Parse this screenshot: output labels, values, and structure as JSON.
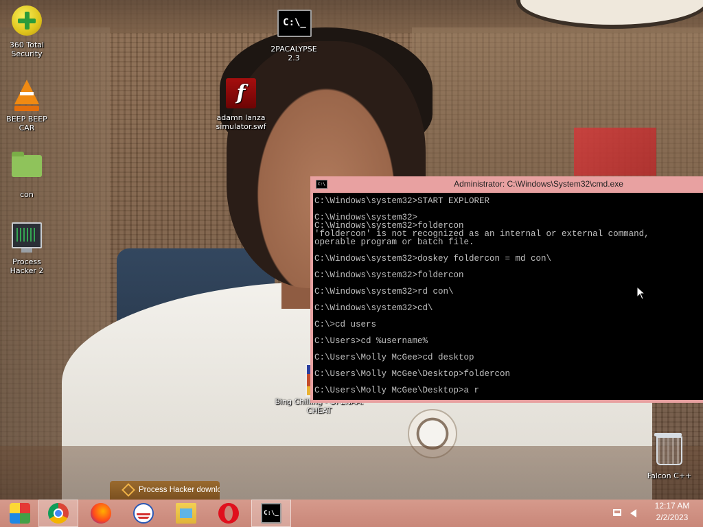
{
  "desktop": {
    "icons": [
      {
        "label": "360 Total Security",
        "icon": "shield-plus-icon"
      },
      {
        "label": "BEEP BEEP CAR",
        "icon": "traffic-cone-icon"
      },
      {
        "label": "con",
        "icon": "folder-icon"
      },
      {
        "label": "Process Hacker 2",
        "icon": "monitor-graph-icon"
      },
      {
        "label": "2PACALYPSE 2.3",
        "icon": "terminal-icon"
      },
      {
        "label": "adamn lanza simulator.swf",
        "icon": "flash-file-icon"
      },
      {
        "label": "Bing Chilling - OPENAA. CHEAT",
        "icon": "game-box-icon"
      },
      {
        "label": "Falcon C++",
        "icon": "recycle-bin-icon"
      }
    ]
  },
  "cmd_window": {
    "title": "Administrator: C:\\Windows\\System32\\cmd.exe",
    "icon_text": "C:\\",
    "lines": [
      "C:\\Windows\\system32>START EXPLORER",
      "",
      "C:\\Windows\\system32>",
      "C:\\Windows\\system32>foldercon",
      "'foldercon' is not recognized as an internal or external command,",
      "operable program or batch file.",
      "",
      "C:\\Windows\\system32>doskey foldercon = md con\\",
      "",
      "C:\\Windows\\system32>foldercon",
      "",
      "C:\\Windows\\system32>rd con\\",
      "",
      "C:\\Windows\\system32>cd\\",
      "",
      "C:\\>cd users",
      "",
      "C:\\Users>cd %username%",
      "",
      "C:\\Users\\Molly McGee>cd desktop",
      "",
      "C:\\Users\\Molly McGee\\Desktop>foldercon",
      "",
      "C:\\Users\\Molly McGee\\Desktop>a r"
    ]
  },
  "notification": {
    "text": "Process Hacker downlo"
  },
  "taskbar": {
    "apps": [
      {
        "name": "start",
        "icon": "windows-logo-icon"
      },
      {
        "name": "chrome",
        "icon": "chrome-icon"
      },
      {
        "name": "firefox",
        "icon": "firefox-icon"
      },
      {
        "name": "obama",
        "icon": "obama-logo-icon"
      },
      {
        "name": "explorer",
        "icon": "file-explorer-icon"
      },
      {
        "name": "opera",
        "icon": "opera-icon"
      },
      {
        "name": "cmd",
        "icon": "cmd-icon",
        "glyph": "C:\\_"
      }
    ],
    "clock_time": "12:17 AM",
    "clock_date": "2/2/2023"
  },
  "colors": {
    "titlebar": "#e8a1a1",
    "taskbar": "#d69a8c",
    "console_bg": "#000000",
    "console_text": "#c0c0c0"
  }
}
